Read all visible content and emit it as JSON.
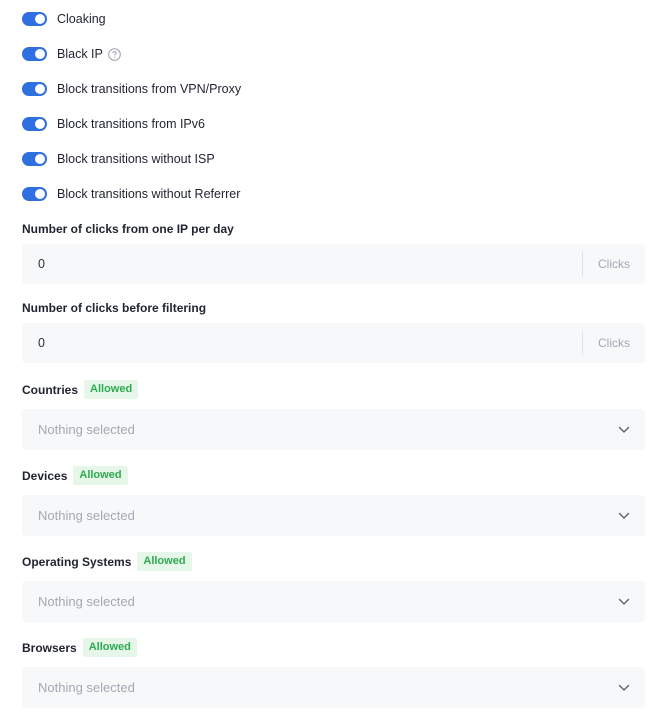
{
  "toggles": [
    {
      "label": "Cloaking",
      "on": true
    },
    {
      "label": "Black IP",
      "on": true,
      "help_icon": "question-circle-icon"
    },
    {
      "label": "Block transitions from VPN/Proxy",
      "on": true
    },
    {
      "label": "Block transitions from IPv6",
      "on": true
    },
    {
      "label": "Block transitions without ISP",
      "on": true
    },
    {
      "label": "Block transitions without Referrer",
      "on": true
    }
  ],
  "clicks_per_ip": {
    "label": "Number of clicks from one IP per day",
    "value": "0",
    "suffix": "Clicks"
  },
  "clicks_before_filtering": {
    "label": "Number of clicks before filtering",
    "value": "0",
    "suffix": "Clicks"
  },
  "filters": [
    {
      "label": "Countries",
      "badge": "Allowed",
      "placeholder": "Nothing selected"
    },
    {
      "label": "Devices",
      "badge": "Allowed",
      "placeholder": "Nothing selected"
    },
    {
      "label": "Operating Systems",
      "badge": "Allowed",
      "placeholder": "Nothing selected"
    },
    {
      "label": "Browsers",
      "badge": "Allowed",
      "placeholder": "Nothing selected"
    }
  ],
  "colors": {
    "accent": "#2f6fe0",
    "badge_bg": "#e6f7ea",
    "badge_text": "#2eaa4f",
    "field_bg": "#f7f8fa",
    "muted_text": "#a3a8b3"
  }
}
